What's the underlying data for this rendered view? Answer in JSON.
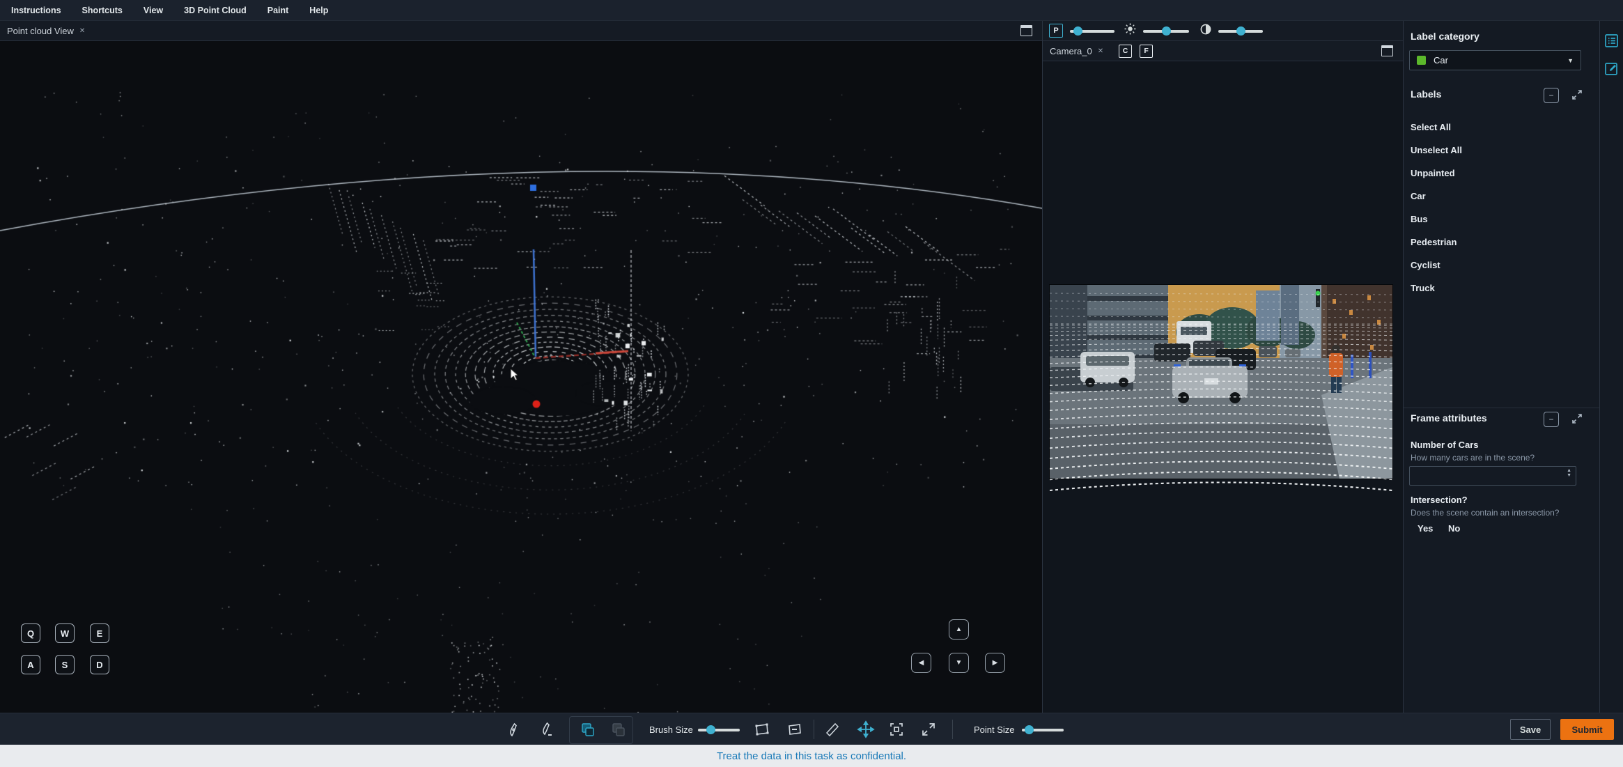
{
  "menu": {
    "items": [
      "Instructions",
      "Shortcuts",
      "View",
      "3D Point Cloud",
      "Paint",
      "Help"
    ]
  },
  "pc_panel": {
    "tab_label": "Point cloud View",
    "keys_row1": [
      "Q",
      "W",
      "E"
    ],
    "keys_row2": [
      "A",
      "S",
      "D"
    ]
  },
  "cam_panel": {
    "tab_label": "Camera_0",
    "c_label": "C",
    "f_label": "F"
  },
  "display_toolbar": {
    "p_label": "P"
  },
  "sidebar": {
    "label_category": {
      "title": "Label category",
      "selected": "Car",
      "color": "#5cb82b"
    },
    "labels_section": {
      "title": "Labels",
      "items": [
        "Select All",
        "Unselect All",
        "Unpainted",
        "Car",
        "Bus",
        "Pedestrian",
        "Cyclist",
        "Truck"
      ]
    },
    "frame_attributes": {
      "title": "Frame attributes",
      "number_of_cars": {
        "label": "Number of Cars",
        "hint": "How many cars are in the scene?",
        "value": ""
      },
      "intersection": {
        "label": "Intersection?",
        "hint": "Does the scene contain an intersection?",
        "options": [
          "Yes",
          "No"
        ]
      }
    }
  },
  "toolbar": {
    "brush_size_label": "Brush Size",
    "point_size_label": "Point Size",
    "save_label": "Save",
    "submit_label": "Submit"
  },
  "footer": {
    "notice": "Treat the data in this task as confidential."
  },
  "icons": {
    "close": "✕",
    "caret_down": "▼",
    "up": "▲",
    "down": "▼",
    "left": "◀",
    "right": "▶",
    "minus": "−"
  },
  "colors": {
    "accent": "#3fb1d0",
    "submit_orange": "#ec7211",
    "label_green": "#5cb82b",
    "footer_link": "#1a7ab8"
  }
}
